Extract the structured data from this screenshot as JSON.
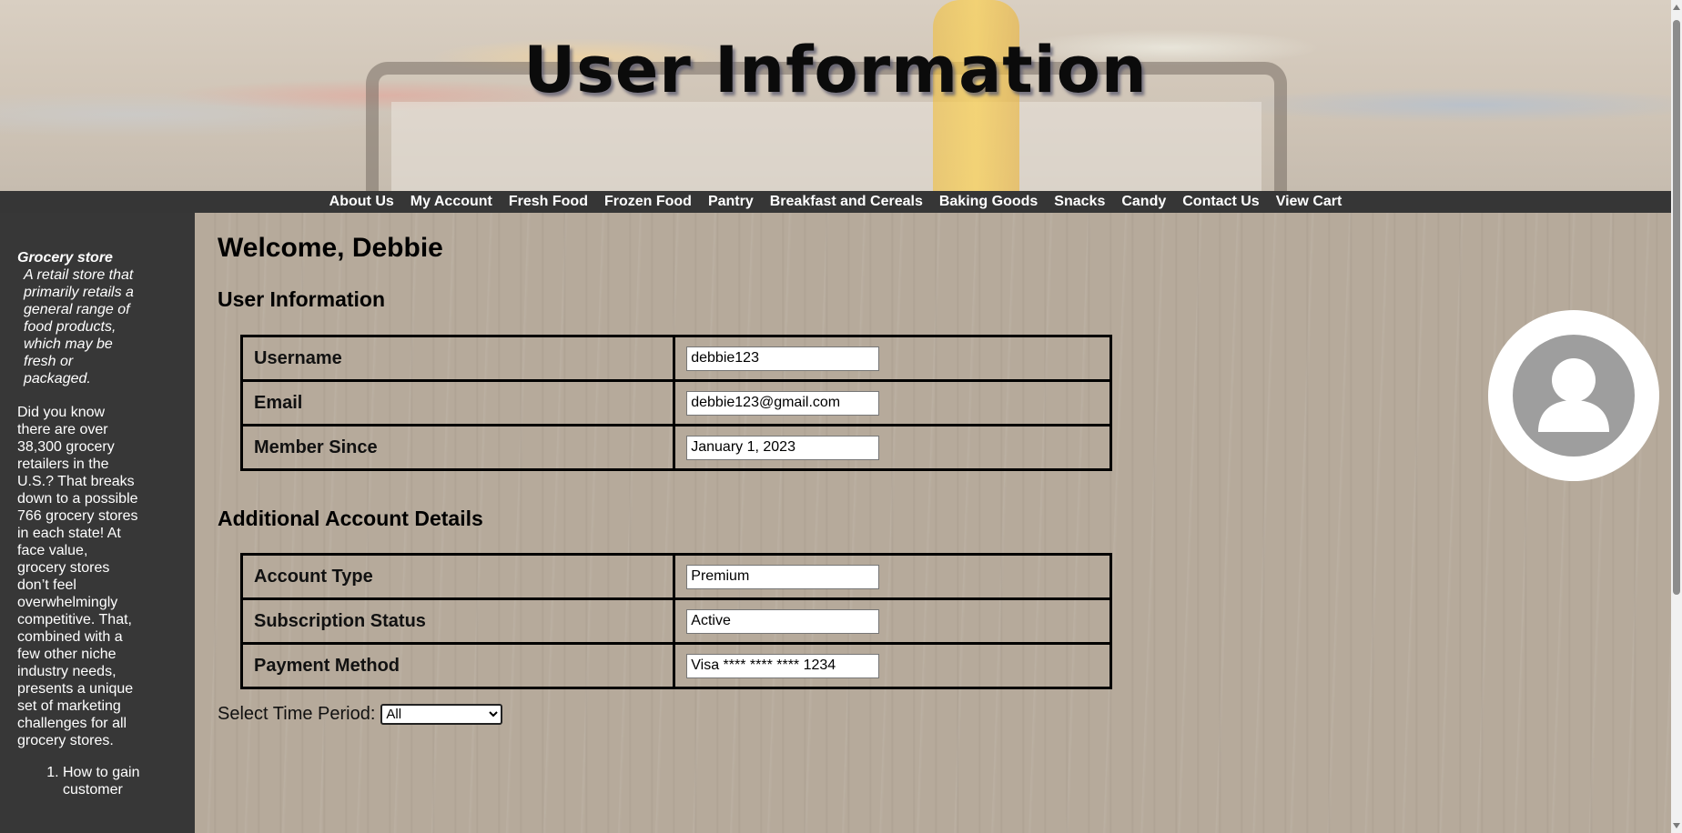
{
  "banner": {
    "title": "User Information"
  },
  "nav": {
    "items": [
      "About Us",
      "My Account",
      "Fresh Food",
      "Frozen Food",
      "Pantry",
      "Breakfast and Cereals",
      "Baking Goods",
      "Snacks",
      "Candy",
      "Contact Us",
      "View Cart"
    ]
  },
  "sidebar": {
    "term": "Grocery store",
    "definition": "A retail store that primarily retails a general range of food products, which may be fresh or packaged.",
    "fact": "Did you know there are over 38,300 grocery retailers in the U.S.? That breaks down to a possible 766 grocery stores in each state! At face value, grocery stores don’t feel overwhelmingly competitive. That, combined with a few other niche industry needs, presents a unique set of marketing challenges for all grocery stores.",
    "list": [
      "How to gain customer"
    ]
  },
  "main": {
    "welcome": "Welcome, Debbie",
    "user_info": {
      "title": "User Information",
      "rows": [
        {
          "label": "Username",
          "value": "debbie123"
        },
        {
          "label": "Email",
          "value": "debbie123@gmail.com"
        },
        {
          "label": "Member Since",
          "value": "January 1, 2023"
        }
      ]
    },
    "account": {
      "title": "Additional Account Details",
      "rows": [
        {
          "label": "Account Type",
          "value": "Premium"
        },
        {
          "label": "Subscription Status",
          "value": "Active"
        },
        {
          "label": "Payment Method",
          "value": "Visa **** **** **** 1234"
        }
      ]
    },
    "period": {
      "label": "Select Time Period:",
      "selected": "All"
    }
  },
  "avatar": {
    "icon": "user-silhouette-icon"
  },
  "colors": {
    "nav_bg": "#363636",
    "sidebar_bg": "#373737",
    "main_bg": "#b6aa9b",
    "avatar_gray": "#9e9e9e"
  }
}
